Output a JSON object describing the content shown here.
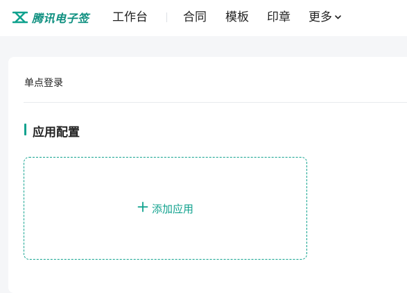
{
  "header": {
    "logo_text": "腾讯电子签",
    "nav": {
      "workbench": "工作台",
      "contract": "合同",
      "template": "模板",
      "seal": "印章",
      "more": "更多"
    }
  },
  "main": {
    "breadcrumb": "单点登录",
    "section_title": "应用配置",
    "add_app_label": "添加应用"
  },
  "colors": {
    "brand": "#10a28e",
    "background": "#f5f6f8"
  },
  "icons": {
    "logo": "logo-icon",
    "more": "chevron-down-icon",
    "add": "plus-icon"
  }
}
